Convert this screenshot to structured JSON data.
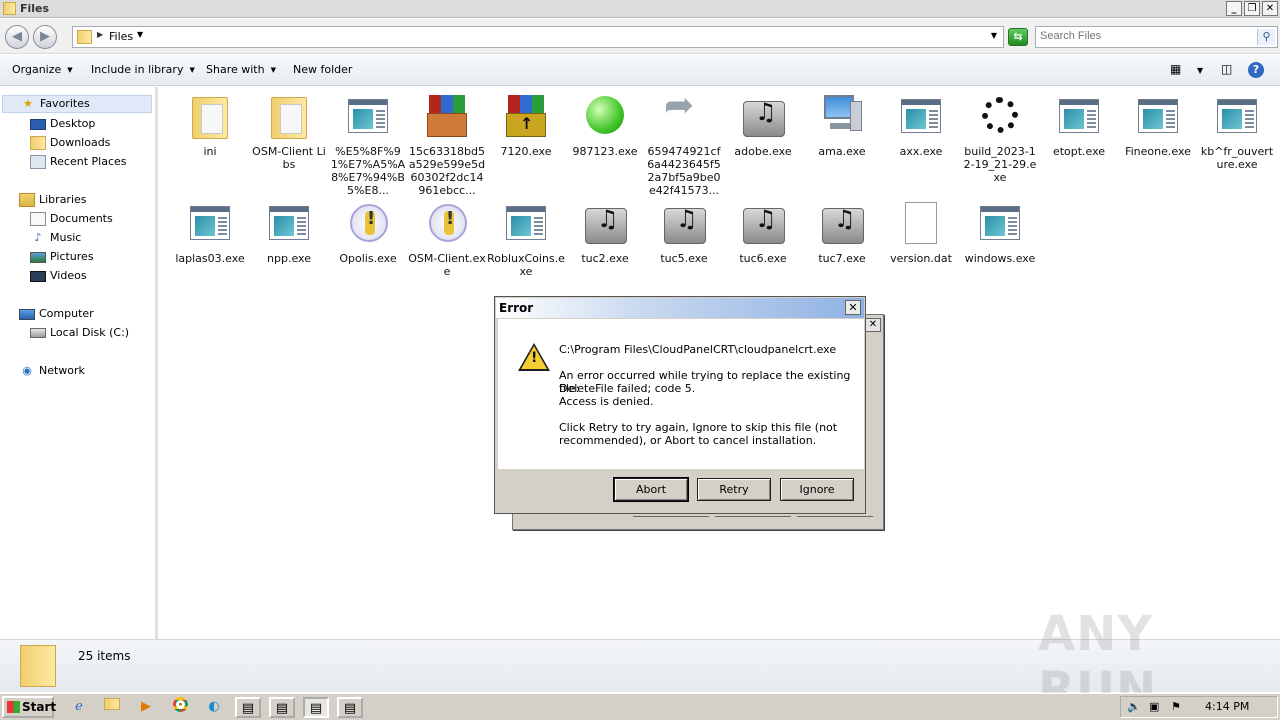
{
  "window": {
    "title": "Files"
  },
  "address": {
    "path": "Files"
  },
  "search": {
    "placeholder": "Search Files"
  },
  "toolbar": {
    "organize": "Organize",
    "include_in_library": "Include in library",
    "share_with": "Share with",
    "new_folder": "New folder"
  },
  "sidebar": {
    "favorites": "Favorites",
    "desktop": "Desktop",
    "downloads": "Downloads",
    "recent_places": "Recent Places",
    "libraries": "Libraries",
    "documents": "Documents",
    "music": "Music",
    "pictures": "Pictures",
    "videos": "Videos",
    "computer": "Computer",
    "local_disk": "Local Disk (C:)",
    "network": "Network"
  },
  "files": [
    {
      "label": "ini",
      "icon": "folder-icon"
    },
    {
      "label": "OSM-Client Libs",
      "icon": "folder-icon"
    },
    {
      "label": "%E5%8F%91%E7%A5%A8%E7%94%B5%E8...",
      "icon": "application-icon"
    },
    {
      "label": "15c63318bd5a529e599e5d60302f2dc14961ebcc...",
      "icon": "winrar-icon"
    },
    {
      "label": "7120.exe",
      "icon": "installer-icon"
    },
    {
      "label": "987123.exe",
      "icon": "green-ball-icon"
    },
    {
      "label": "659474921cf6a4423645f52a7bf5a9be0e42f41573...",
      "icon": "shortcut-arrow-icon"
    },
    {
      "label": "adobe.exe",
      "icon": "audio-icon"
    },
    {
      "label": "ama.exe",
      "icon": "computer-icon"
    },
    {
      "label": "axx.exe",
      "icon": "application-icon"
    },
    {
      "label": "build_2023-12-19_21-29.exe",
      "icon": "spinner-icon"
    },
    {
      "label": "etopt.exe",
      "icon": "application-icon"
    },
    {
      "label": "Fineone.exe",
      "icon": "application-icon"
    },
    {
      "label": "kb^fr_ouverture.exe",
      "icon": "application-icon"
    },
    {
      "label": "laplas03.exe",
      "icon": "application-icon"
    },
    {
      "label": "npp.exe",
      "icon": "application-icon"
    },
    {
      "label": "Opolis.exe",
      "icon": "warning-file-icon"
    },
    {
      "label": "OSM-Client.exe",
      "icon": "warning-file-icon"
    },
    {
      "label": "RobluxCoins.exe",
      "icon": "application-icon"
    },
    {
      "label": "tuc2.exe",
      "icon": "audio-icon"
    },
    {
      "label": "tuc5.exe",
      "icon": "audio-icon"
    },
    {
      "label": "tuc6.exe",
      "icon": "audio-icon"
    },
    {
      "label": "tuc7.exe",
      "icon": "audio-icon"
    },
    {
      "label": "version.dat",
      "icon": "blank-file-icon"
    },
    {
      "label": "windows.exe",
      "icon": "application-icon"
    }
  ],
  "status": {
    "item_count": "25 items"
  },
  "dialog": {
    "title": "Error",
    "path": "C:\\Program Files\\CloudPanelCRT\\cloudpanelcrt.exe",
    "message_line1": "An error occurred while trying to replace the existing file:",
    "message_line2": "DeleteFile failed; code 5.",
    "message_line3": "Access is denied.",
    "hint_line1": "Click Retry to try again, Ignore to skip this file (not",
    "hint_line2": "recommended), or Abort to cancel installation.",
    "buttons": {
      "abort": "Abort",
      "retry": "Retry",
      "ignore": "Ignore"
    }
  },
  "taskbar": {
    "start": "Start",
    "clock": "4:14 PM"
  },
  "watermark": "ANY RUN"
}
